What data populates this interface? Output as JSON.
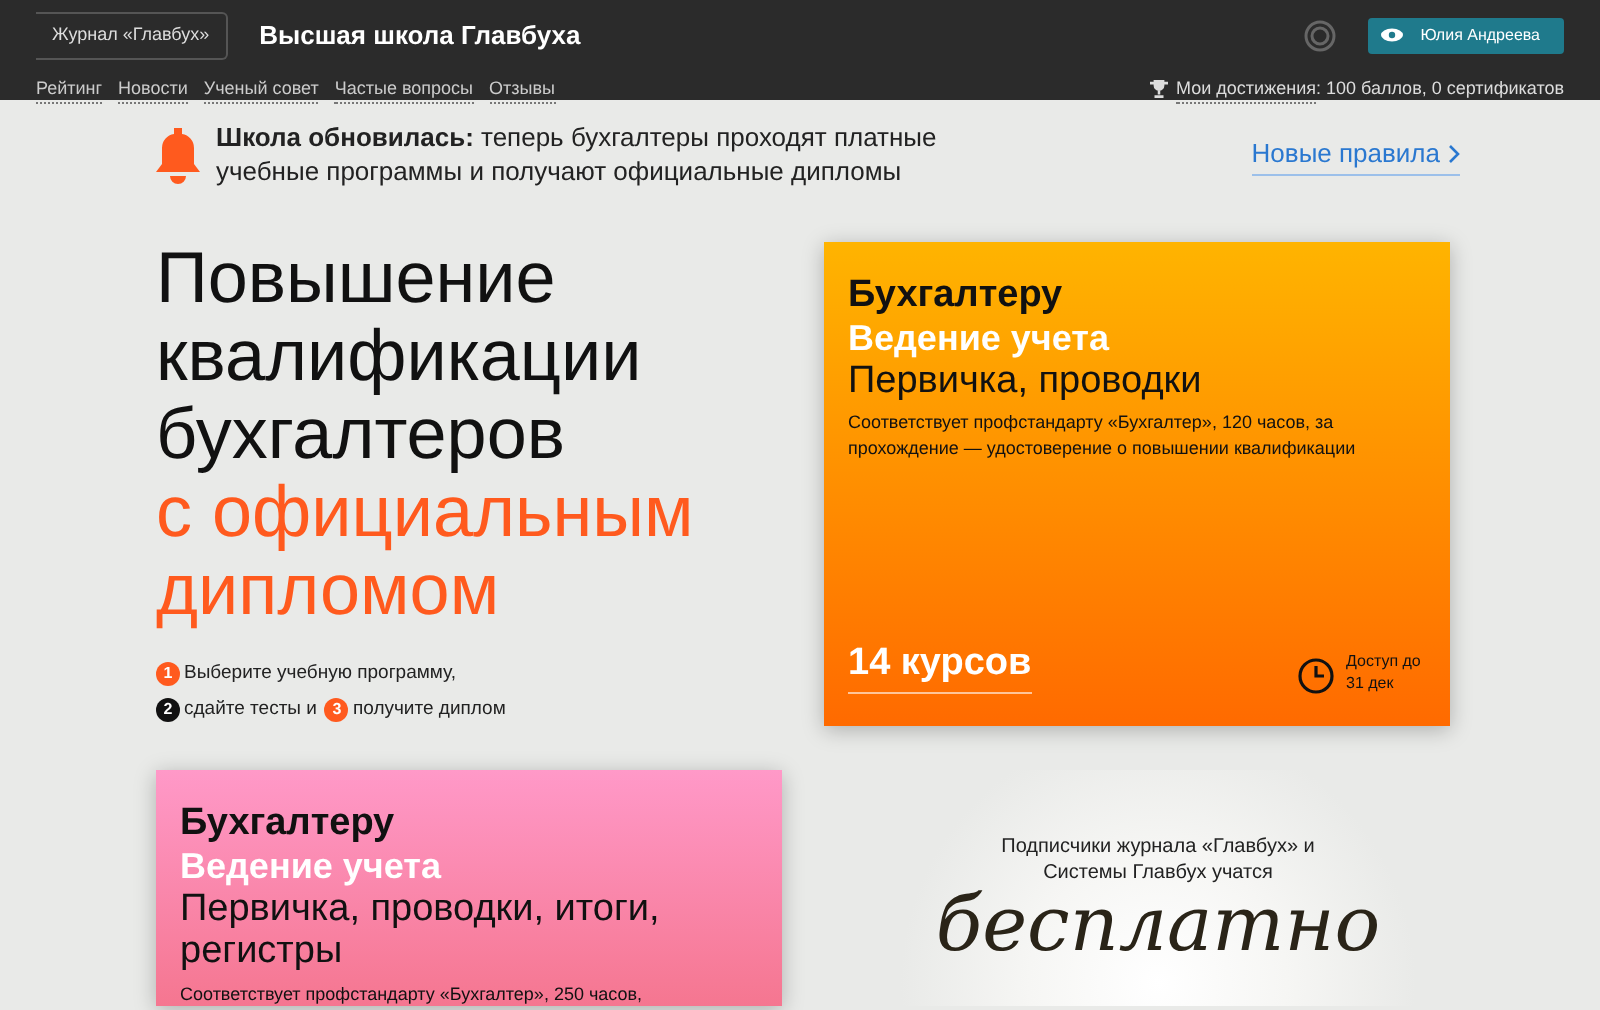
{
  "header": {
    "back_link": "Журнал «Главбух»",
    "site_title": "Высшая школа Главбуха",
    "nav": [
      "Рейтинг",
      "Новости",
      "Ученый совет",
      "Частые вопросы",
      "Отзывы"
    ],
    "user_button": "Юлия Андреева",
    "achievements": {
      "link": "Мои достижения",
      "text": ": 100 баллов, 0 сертификатов"
    }
  },
  "notice": {
    "text": "**Школа обновилась:** теперь бухгалтеры проходят платные учебные программы и получают официальные дипломы",
    "link": "Новые правила"
  },
  "hero": {
    "title_lines": [
      "Повышение",
      "квалификации",
      "бухгалтеров"
    ],
    "accent_lines": [
      "с официальным",
      "дипломом"
    ],
    "steps": [
      {
        "number": "1",
        "text": "Выберите учебную программу,",
        "color": "#ff5a1e"
      },
      {
        "number": "2",
        "text": "сдайте тесты и",
        "color": "#111111"
      },
      {
        "number": "3",
        "text": "получите диплом",
        "color": "#ff5a1e"
      }
    ]
  },
  "courses": [
    {
      "kind": "orange",
      "audience": "Бухгалтеру",
      "subject": "Ведение учета",
      "topic": "Первичка, проводки",
      "description": "Соответствует профстандарту «Бухгалтер», 120 часов, за прохождение — удостоверение о повышении квалификации",
      "count": "14 курсов",
      "access": "Доступ до 31 дек"
    },
    {
      "kind": "pink",
      "audience": "Бухгалтеру",
      "subject": "Ведение учета",
      "topic": "Первичка, проводки, итоги, регистры",
      "description": "Соответствует профстандарту «Бухгалтер», 250 часов,"
    }
  ],
  "promo": {
    "caption": "Подписчики журнала «Главбух» и Системы Главбух учатся",
    "word": "бесплатно"
  }
}
